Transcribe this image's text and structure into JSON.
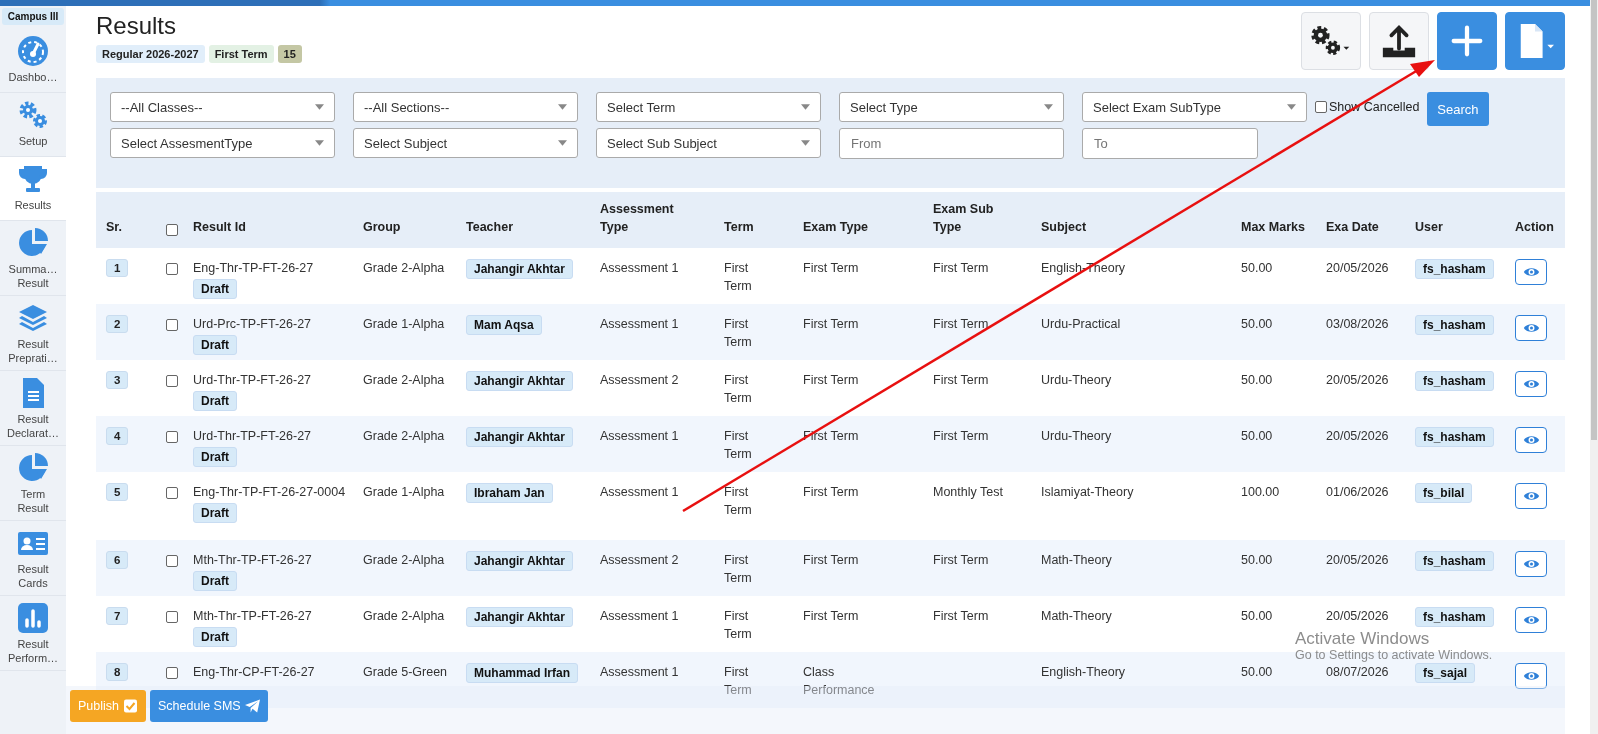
{
  "campus": "Campus III",
  "sidebar": {
    "items": [
      {
        "label": "Dashbo…",
        "kind": "gauge",
        "selected": false
      },
      {
        "label": "Setup",
        "kind": "gears",
        "selected": false
      },
      {
        "label": "Results",
        "kind": "trophy",
        "selected": true
      },
      {
        "label": "Summa… Result",
        "kind": "pie",
        "selected": false
      },
      {
        "label": "Result Preprati…",
        "kind": "layers",
        "selected": false
      },
      {
        "label": "Result Declarat…",
        "kind": "document",
        "selected": false
      },
      {
        "label": "Term Result",
        "kind": "pie",
        "selected": false
      },
      {
        "label": "Result Cards",
        "kind": "card",
        "selected": false
      },
      {
        "label": "Result Perform…",
        "kind": "bars",
        "selected": false
      }
    ]
  },
  "title": "Results",
  "tags": [
    {
      "text": "Regular 2026-2027",
      "kind": "session"
    },
    {
      "text": "First Term",
      "kind": "term"
    },
    {
      "text": "15",
      "kind": "count"
    }
  ],
  "toolbar": [
    {
      "kind": "gears"
    },
    {
      "kind": "upload"
    },
    {
      "kind": "add"
    },
    {
      "kind": "file"
    }
  ],
  "filters": [
    {
      "kind": "select",
      "value": "--All Classes--"
    },
    {
      "kind": "select",
      "value": "--All Sections--"
    },
    {
      "kind": "select",
      "value": "Select Term"
    },
    {
      "kind": "select",
      "value": "Select Type"
    },
    {
      "kind": "select",
      "value": "Select Exam SubType"
    },
    {
      "kind": "select",
      "value": "Select AssesmentType"
    },
    {
      "kind": "select",
      "value": "Select Subject"
    },
    {
      "kind": "select",
      "value": "Select Sub Subject"
    },
    {
      "kind": "input",
      "placeholder": "From"
    },
    {
      "kind": "input",
      "placeholder": "To"
    }
  ],
  "show_cancelled": {
    "label": "Show Cancelled",
    "checked": false
  },
  "search_button": "Search",
  "table": {
    "select_all_checked": false,
    "columns": [
      "Sr.",
      "Result Id",
      "Group",
      "Teacher",
      "Assessment Type",
      "Term",
      "Exam Type",
      "Exam Sub Type",
      "Subject",
      "Max Marks",
      "Exa Date",
      "User",
      "Action"
    ],
    "rows": [
      {
        "sr": "1",
        "checked": false,
        "result_id": "Eng-Thr-TP-FT-26-27",
        "status": "Draft",
        "group": "Grade 2-Alpha",
        "teacher": "Jahangir Akhtar",
        "assessment_type": "Assessment 1",
        "term": "First Term",
        "exam_type": "First Term",
        "exam_sub_type": "First Term",
        "subject": "English-Theory",
        "max_marks": "50.00",
        "date": "20/05/2026",
        "user": "fs_hasham"
      },
      {
        "sr": "2",
        "checked": false,
        "result_id": "Urd-Prc-TP-FT-26-27",
        "status": "Draft",
        "group": "Grade 1-Alpha",
        "teacher": "Mam Aqsa",
        "assessment_type": "Assessment 1",
        "term": "First Term",
        "exam_type": "First Term",
        "exam_sub_type": "First Term",
        "subject": "Urdu-Practical",
        "max_marks": "50.00",
        "date": "03/08/2026",
        "user": "fs_hasham"
      },
      {
        "sr": "3",
        "checked": false,
        "result_id": "Urd-Thr-TP-FT-26-27",
        "status": "Draft",
        "group": "Grade 2-Alpha",
        "teacher": "Jahangir Akhtar",
        "assessment_type": "Assessment 2",
        "term": "First Term",
        "exam_type": "First Term",
        "exam_sub_type": "First Term",
        "subject": "Urdu-Theory",
        "max_marks": "50.00",
        "date": "20/05/2026",
        "user": "fs_hasham"
      },
      {
        "sr": "4",
        "checked": false,
        "result_id": "Urd-Thr-TP-FT-26-27",
        "status": "Draft",
        "group": "Grade 2-Alpha",
        "teacher": "Jahangir Akhtar",
        "assessment_type": "Assessment 1",
        "term": "First Term",
        "exam_type": "First Term",
        "exam_sub_type": "First Term",
        "subject": "Urdu-Theory",
        "max_marks": "50.00",
        "date": "20/05/2026",
        "user": "fs_hasham"
      },
      {
        "sr": "5",
        "checked": false,
        "result_id": "Eng-Thr-TP-FT-26-27-0004",
        "status": "Draft",
        "group": "Grade 1-Alpha",
        "teacher": "Ibraham Jan",
        "assessment_type": "Assessment 1",
        "term": "First Term",
        "exam_type": "First Term",
        "exam_sub_type": "Monthly Test",
        "subject": "Islamiyat-Theory",
        "max_marks": "100.00",
        "date": "01/06/2026",
        "user": "fs_bilal"
      },
      {
        "sr": "6",
        "checked": false,
        "result_id": "Mth-Thr-TP-FT-26-27",
        "status": "Draft",
        "group": "Grade 2-Alpha",
        "teacher": "Jahangir Akhtar",
        "assessment_type": "Assessment 2",
        "term": "First Term",
        "exam_type": "First Term",
        "exam_sub_type": "First Term",
        "subject": "Math-Theory",
        "max_marks": "50.00",
        "date": "20/05/2026",
        "user": "fs_hasham"
      },
      {
        "sr": "7",
        "checked": false,
        "result_id": "Mth-Thr-TP-FT-26-27",
        "status": "Draft",
        "group": "Grade 2-Alpha",
        "teacher": "Jahangir Akhtar",
        "assessment_type": "Assessment 1",
        "term": "First Term",
        "exam_type": "First Term",
        "exam_sub_type": "First Term",
        "subject": "Math-Theory",
        "max_marks": "50.00",
        "date": "20/05/2026",
        "user": "fs_hasham"
      },
      {
        "sr": "8",
        "checked": false,
        "result_id": "Eng-Thr-CP-FT-26-27",
        "group": "Grade 5-Green",
        "teacher": "Muhammad Irfan",
        "assessment_type": "Assessment 1",
        "term": "First Term",
        "exam_type": "Class Performance",
        "subject": "English-Theory",
        "max_marks": "50.00",
        "date": "08/07/2026",
        "user": "fs_sajal"
      }
    ]
  },
  "footer_buttons": [
    {
      "label": "Publish",
      "kind": "publish"
    },
    {
      "label": "Schedule SMS",
      "kind": "sms"
    }
  ],
  "activation": {
    "title": "Activate Windows",
    "subtitle": "Go to Settings to activate Windows."
  }
}
